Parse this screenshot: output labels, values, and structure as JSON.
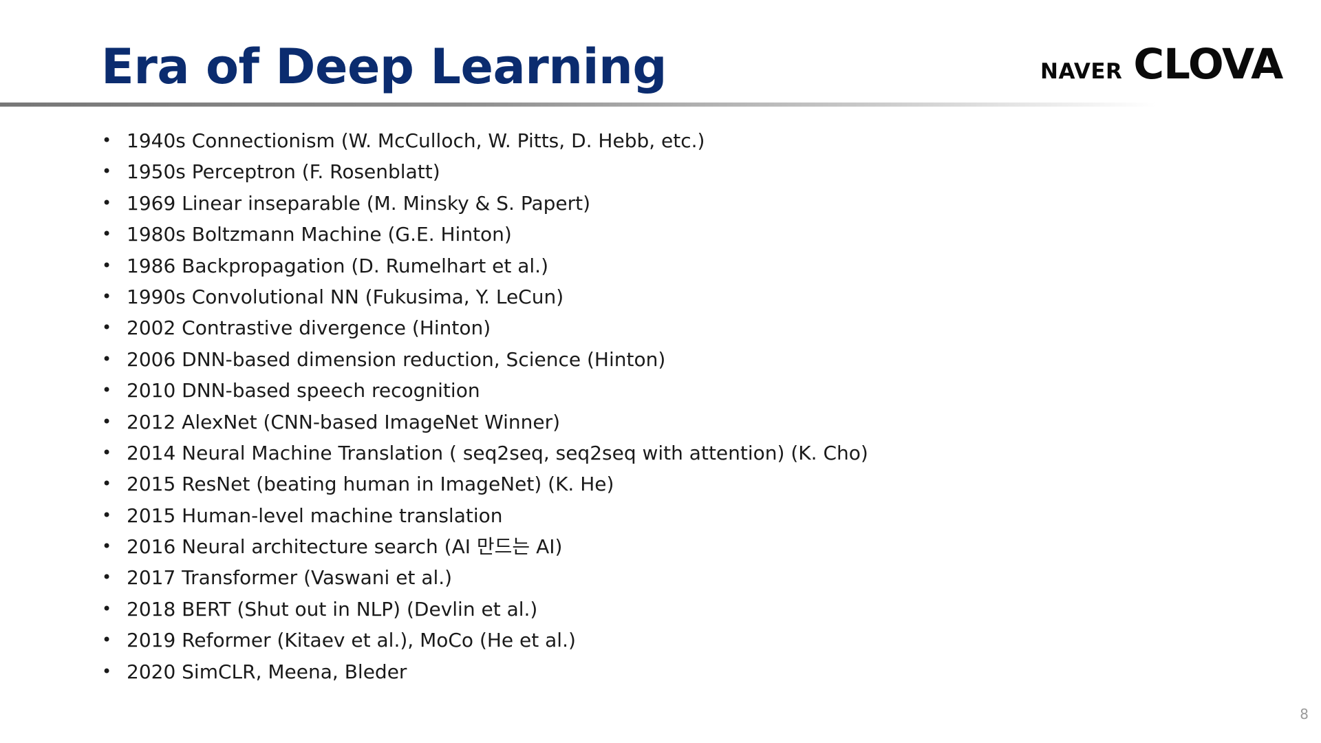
{
  "slide": {
    "title": "Era of Deep Learning",
    "logo": {
      "naver": "NAVER",
      "clova": "CLOVA"
    },
    "bullet_char": "•",
    "items": [
      "1940s Connectionism (W. McCulloch, W. Pitts, D. Hebb, etc.)",
      "1950s Perceptron (F. Rosenblatt)",
      "1969 Linear inseparable (M. Minsky & S. Papert)",
      "1980s Boltzmann Machine (G.E. Hinton)",
      "1986 Backpropagation (D. Rumelhart et al.)",
      "1990s Convolutional NN (Fukusima, Y. LeCun)",
      "2002 Contrastive divergence (Hinton)",
      "2006 DNN-based dimension reduction, Science (Hinton)",
      "2010 DNN-based speech recognition",
      "2012 AlexNet (CNN-based ImageNet Winner)",
      "2014 Neural Machine Translation ( seq2seq, seq2seq with attention) (K. Cho)",
      "2015 ResNet (beating human in ImageNet) (K. He)",
      "2015 Human-level machine translation",
      "2016 Neural architecture search (AI 만드는 AI)",
      "2017 Transformer (Vaswani et al.)",
      "2018 BERT (Shut out in NLP) (Devlin et al.)",
      "2019 Reformer (Kitaev et al.), MoCo (He et al.)",
      "2020 SimCLR, Meena, Bleder"
    ],
    "page_number": "8"
  },
  "colors": {
    "title": "#0b2c6f",
    "text": "#1a1a1a",
    "logo": "#0a0a0a",
    "rule": "#777777",
    "page_number": "#9a9a9a"
  }
}
